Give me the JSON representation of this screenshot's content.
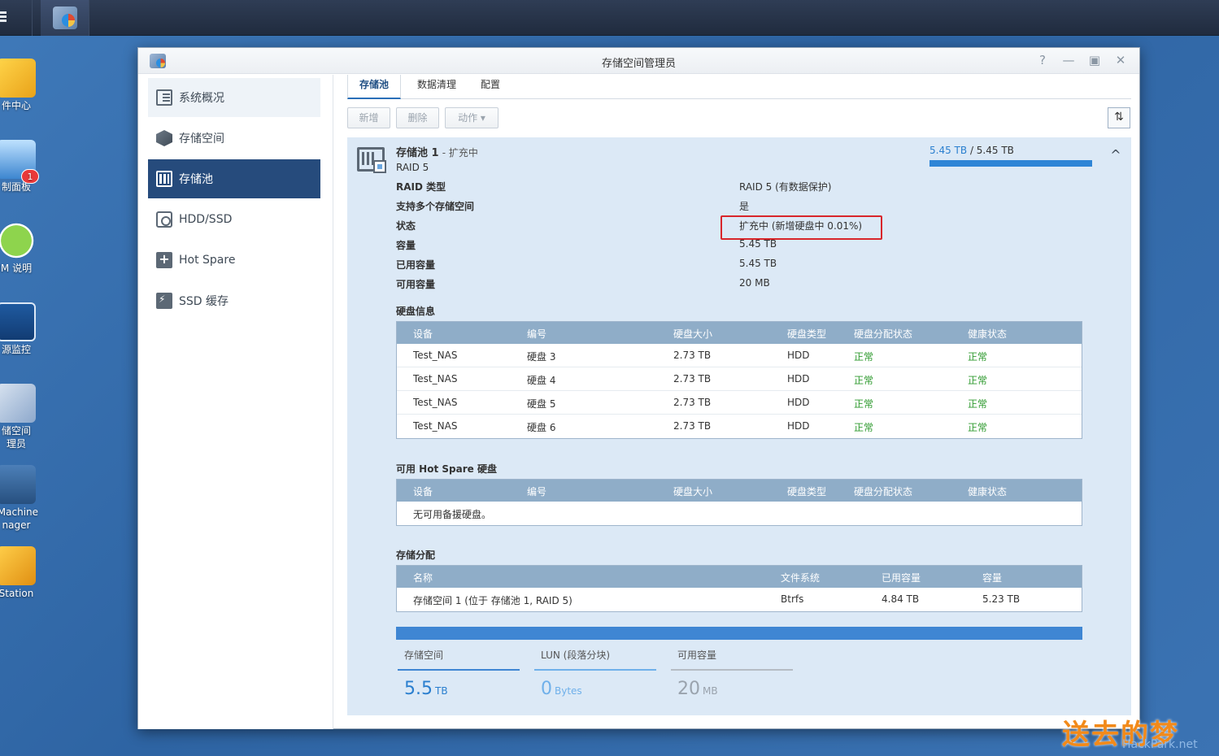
{
  "desktop": {
    "icons": [
      {
        "label": "件中心"
      },
      {
        "label": "制面板",
        "badge": "1"
      },
      {
        "label": "M 说明"
      },
      {
        "label": "源监控"
      },
      {
        "label": "储空间\n理员"
      },
      {
        "label": " Machine\nnager"
      },
      {
        "label": "Station"
      }
    ]
  },
  "window": {
    "title": "存储空间管理员",
    "controls": {
      "help": "?",
      "minimize": "—",
      "maximize": "▣",
      "close": "✕"
    }
  },
  "sidebar": {
    "items": [
      {
        "label": "系统概况",
        "icon": "overview-icon"
      },
      {
        "label": "存储空间",
        "icon": "volume-icon"
      },
      {
        "label": "存储池",
        "icon": "storage-pool-icon"
      },
      {
        "label": "HDD/SSD",
        "icon": "hdd-icon"
      },
      {
        "label": "Hot Spare",
        "icon": "hot-spare-icon"
      },
      {
        "label": "SSD 缓存",
        "icon": "ssd-cache-icon"
      }
    ]
  },
  "tabs": [
    "存储池",
    "数据清理",
    "配置"
  ],
  "toolbar": {
    "add": "新增",
    "delete": "删除",
    "action": "动作 ▾",
    "sort": "⇅"
  },
  "pool": {
    "name": "存储池 1",
    "state_suffix": "- 扩充中",
    "raid": "RAID 5",
    "usage_used": "5.45 TB",
    "usage_total": "/ 5.45 TB",
    "usage_fraction": 1.0,
    "collapse": "^",
    "props": [
      {
        "k": "RAID 类型",
        "v": "RAID 5 (有数据保护)"
      },
      {
        "k": "支持多个存储空间",
        "v": "是"
      },
      {
        "k": "状态",
        "v": "扩充中 (新增硬盘中 0.01%)"
      },
      {
        "k": "容量",
        "v": "5.45 TB"
      },
      {
        "k": "已用容量",
        "v": "5.45 TB"
      },
      {
        "k": "可用容量",
        "v": "20 MB"
      }
    ]
  },
  "disk_info": {
    "title": "硬盘信息",
    "headers": [
      "设备",
      "编号",
      "硬盘大小",
      "硬盘类型",
      "硬盘分配状态",
      "健康状态"
    ],
    "rows": [
      [
        "Test_NAS",
        "硬盘 3",
        "2.73 TB",
        "HDD",
        "正常",
        "正常"
      ],
      [
        "Test_NAS",
        "硬盘 4",
        "2.73 TB",
        "HDD",
        "正常",
        "正常"
      ],
      [
        "Test_NAS",
        "硬盘 5",
        "2.73 TB",
        "HDD",
        "正常",
        "正常"
      ],
      [
        "Test_NAS",
        "硬盘 6",
        "2.73 TB",
        "HDD",
        "正常",
        "正常"
      ]
    ]
  },
  "hot_spare": {
    "title": "可用 Hot Spare 硬盘",
    "headers": [
      "设备",
      "编号",
      "硬盘大小",
      "硬盘类型",
      "硬盘分配状态",
      "健康状态"
    ],
    "empty": "无可用备援硬盘。"
  },
  "allocation": {
    "title": "存储分配",
    "headers": [
      "名称",
      "文件系统",
      "已用容量",
      "容量"
    ],
    "rows": [
      [
        "存储空间 1 (位于 存储池 1, RAID 5)",
        "Btrfs",
        "4.84 TB",
        "5.23 TB"
      ]
    ]
  },
  "stats": [
    {
      "label": "存储空间",
      "value": "5.5",
      "unit": "TB",
      "color": "#2a7fcf"
    },
    {
      "label": "LUN (段落分块)",
      "value": "0",
      "unit": "Bytes",
      "color": "#6fb0ea"
    },
    {
      "label": "可用容量",
      "value": "20",
      "unit": "MB",
      "color": "#b5bcc4"
    }
  ],
  "watermark": {
    "text": "送去的梦",
    "url": "HackPark.net"
  }
}
